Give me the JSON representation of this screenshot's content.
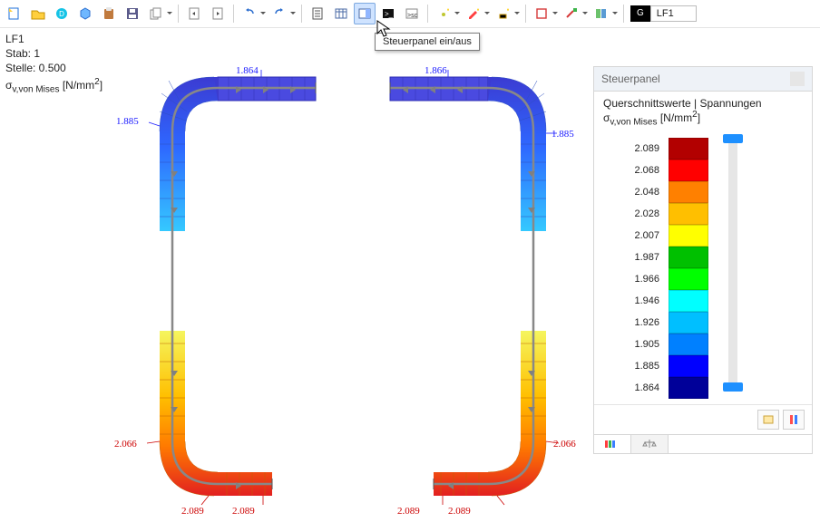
{
  "toolbar": {
    "tooltip": "Steuerpanel ein/aus",
    "lfPill": {
      "g": "G",
      "label": "LF1"
    }
  },
  "info": {
    "lf": "LF1",
    "stab": "Stab: 1",
    "stelle": "Stelle: 0.500",
    "quantity_prefix": "σ",
    "quantity_sub": "v,von Mises",
    "quantity_unit": "[N/mm",
    "quantity_exp": "2",
    "quantity_unit_close": "]"
  },
  "panel": {
    "title": "Steuerpanel",
    "heading": "Querschnittswerte | Spannungen",
    "sub_prefix": "σ",
    "sub_sub": "v,von Mises",
    "sub_unit": "[N/mm",
    "sub_exp": "2",
    "sub_close": "]"
  },
  "legend": [
    {
      "value": "2.089",
      "color": "#b20000"
    },
    {
      "value": "2.068",
      "color": "#ff0000"
    },
    {
      "value": "2.048",
      "color": "#ff8000"
    },
    {
      "value": "2.028",
      "color": "#ffbf00"
    },
    {
      "value": "2.007",
      "color": "#ffff00"
    },
    {
      "value": "1.987",
      "color": "#00c000"
    },
    {
      "value": "1.966",
      "color": "#00ff00"
    },
    {
      "value": "1.946",
      "color": "#00ffff"
    },
    {
      "value": "1.926",
      "color": "#00bfff"
    },
    {
      "value": "1.905",
      "color": "#0080ff"
    },
    {
      "value": "1.885",
      "color": "#0000ff"
    },
    {
      "value": "1.864",
      "color": "#000099"
    }
  ],
  "viewer": {
    "labels": {
      "top_left": "1.864",
      "top_right": "1.866",
      "mid_left": "1.885",
      "mid_right": "1.885",
      "low_left": "2.066",
      "low_right": "2.066",
      "bot_left_a": "2.089",
      "bot_left_b": "2.089",
      "bot_right_a": "2.089",
      "bot_right_b": "2.089"
    }
  },
  "chart_data": {
    "type": "heatmap",
    "title": "Querschnittswerte | Spannungen — σ_v,von Mises",
    "unit": "N/mm²",
    "colorbar": {
      "min": 1.864,
      "max": 2.089,
      "ticks": [
        2.089,
        2.068,
        2.048,
        2.028,
        2.007,
        1.987,
        1.966,
        1.946,
        1.926,
        1.905,
        1.885,
        1.864
      ],
      "colors": [
        "#b20000",
        "#ff0000",
        "#ff8000",
        "#ffbf00",
        "#ffff00",
        "#00c000",
        "#00ff00",
        "#00ffff",
        "#00bfff",
        "#0080ff",
        "#0000ff",
        "#000099"
      ]
    },
    "annotations": [
      {
        "pos": "upper-left-flange",
        "value": 1.864
      },
      {
        "pos": "upper-right-flange",
        "value": 1.866
      },
      {
        "pos": "left-web-upper",
        "value": 1.885
      },
      {
        "pos": "right-web-upper",
        "value": 1.885
      },
      {
        "pos": "left-web-lower",
        "value": 2.066
      },
      {
        "pos": "right-web-lower",
        "value": 2.066
      },
      {
        "pos": "lower-left-lip-a",
        "value": 2.089
      },
      {
        "pos": "lower-left-lip-b",
        "value": 2.089
      },
      {
        "pos": "lower-right-lip-a",
        "value": 2.089
      },
      {
        "pos": "lower-right-lip-b",
        "value": 2.089
      }
    ],
    "meta": {
      "loadcase": "LF1",
      "member": 1,
      "position": 0.5
    }
  }
}
